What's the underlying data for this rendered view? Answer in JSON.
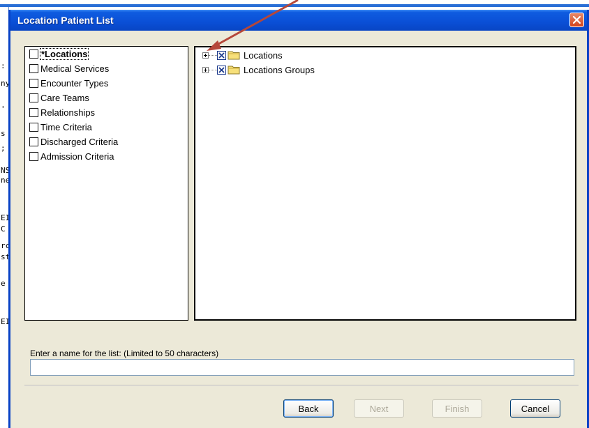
{
  "dialog": {
    "title": "Location Patient List",
    "close_icon": "close-icon"
  },
  "criteria": [
    {
      "label": "*Locations",
      "checked": false,
      "selected": true
    },
    {
      "label": "Medical Services",
      "checked": false
    },
    {
      "label": "Encounter Types",
      "checked": false
    },
    {
      "label": "Care Teams",
      "checked": false
    },
    {
      "label": "Relationships",
      "checked": false
    },
    {
      "label": "Time Criteria",
      "checked": false
    },
    {
      "label": "Discharged Criteria",
      "checked": false
    },
    {
      "label": "Admission Criteria",
      "checked": false
    }
  ],
  "tree": [
    {
      "label": "Locations",
      "checked": true,
      "icon": "folder-icon"
    },
    {
      "label": "Locations Groups",
      "checked": true,
      "icon": "folder-icon"
    }
  ],
  "name_field": {
    "label": "Enter a name for the list: (Limited to 50 characters)",
    "value": ""
  },
  "buttons": {
    "back": "Back",
    "next": "Next",
    "finish": "Finish",
    "cancel": "Cancel"
  },
  "background_fragments": [
    ":",
    "ny",
    "'",
    "s",
    ";",
    "NS",
    "ne",
    "EI",
    "C",
    "rc",
    "st",
    "e",
    "EI"
  ],
  "colors": {
    "titlebar": "#0a4fd6",
    "dialog_bg": "#ece9d8",
    "close_button": "#d1431c",
    "annotation_arrow": "#b5473a"
  }
}
